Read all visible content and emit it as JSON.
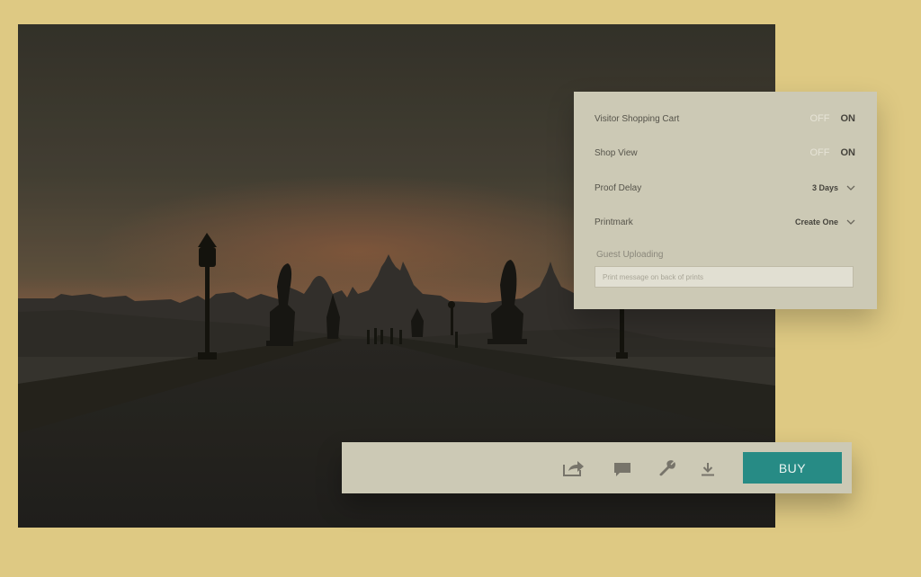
{
  "settings": {
    "visitor_cart": {
      "label": "Visitor Shopping Cart",
      "off": "OFF",
      "on": "ON"
    },
    "shop_view": {
      "label": "Shop View",
      "off": "OFF",
      "on": "ON"
    },
    "proof_delay": {
      "label": "Proof Delay",
      "value": "3 Days"
    },
    "printmark": {
      "label": "Printmark",
      "value": "Create One"
    },
    "guest_uploading": {
      "label": "Guest Uploading",
      "placeholder": "Print message on back of prints"
    }
  },
  "toolbar": {
    "icons": [
      "share-icon",
      "comment-icon",
      "wrench-icon",
      "download-icon"
    ],
    "buy_label": "BUY"
  },
  "colors": {
    "accent": "#278b85",
    "background": "#dec983",
    "panel": "#ccc9b5"
  }
}
